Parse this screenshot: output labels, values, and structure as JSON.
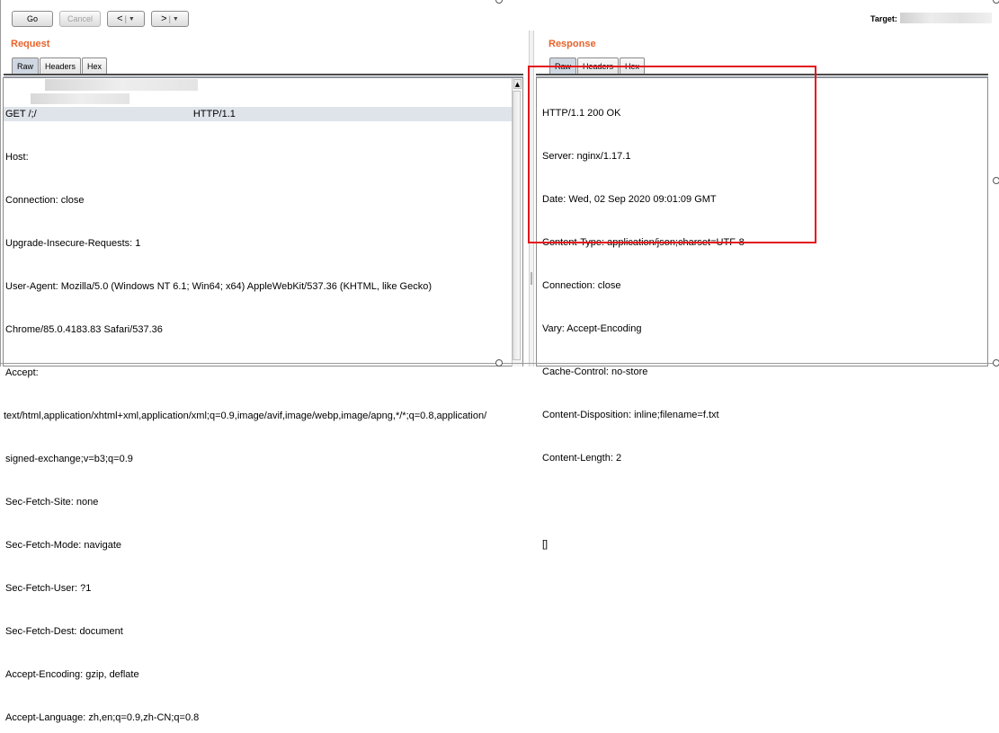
{
  "toolbar": {
    "go_label": "Go",
    "cancel_label": "Cancel",
    "back_label": "<",
    "forward_label": ">",
    "dropdown_glyph": "▼",
    "target_label": "Target:"
  },
  "request": {
    "title": "Request",
    "tabs": [
      "Raw",
      "Headers",
      "Hex"
    ],
    "lines": [
      "GET /;/                                                         HTTP/1.1",
      "Host: ",
      "Connection: close",
      "Upgrade-Insecure-Requests: 1",
      "User-Agent: Mozilla/5.0 (Windows NT 6.1; Win64; x64) AppleWebKit/537.36 (KHTML, like Gecko)",
      "Chrome/85.0.4183.83 Safari/537.36",
      "Accept:",
      "text/html,application/xhtml+xml,application/xml;q=0.9,image/avif,image/webp,image/apng,*/*;q=0.8,application/",
      "signed-exchange;v=b3;q=0.9",
      "Sec-Fetch-Site: none",
      "Sec-Fetch-Mode: navigate",
      "Sec-Fetch-User: ?1",
      "Sec-Fetch-Dest: document",
      "Accept-Encoding: gzip, deflate",
      "Accept-Language: zh,en;q=0.9,zh-CN;q=0.8"
    ],
    "scroll_up_glyph": "▲"
  },
  "response": {
    "title": "Response",
    "tabs": [
      "Raw",
      "Headers",
      "Hex"
    ],
    "lines": [
      "HTTP/1.1 200 OK",
      "Server: nginx/1.17.1",
      "Date: Wed, 02 Sep 2020 09:01:09 GMT",
      "Content-Type: application/json;charset=UTF-8",
      "Connection: close",
      "Vary: Accept-Encoding",
      "Cache-Control: no-store",
      "Content-Disposition: inline;filename=f.txt",
      "Content-Length: 2",
      "",
      "[]"
    ]
  },
  "colors": {
    "section_title": "#e8632a",
    "highlight_box": "#e3161b",
    "active_tab": "#cfd7e2"
  }
}
